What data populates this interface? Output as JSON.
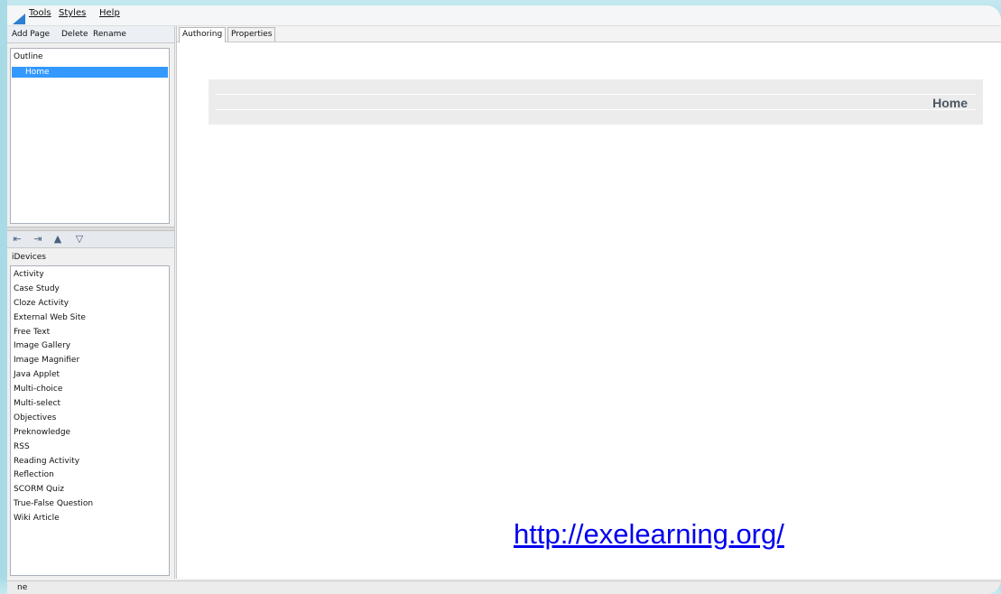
{
  "menubar": {
    "items": [
      "Tools",
      "Styles",
      "Help"
    ]
  },
  "outline_toolbar": {
    "add_page": "Add Page",
    "delete": "Delete",
    "rename": "Rename"
  },
  "outline": {
    "header": "Outline",
    "selected_item": "Home"
  },
  "move_toolbar": {
    "icons": [
      "promote-icon",
      "demote-icon",
      "move-up-icon",
      "move-down-icon"
    ]
  },
  "idevices": {
    "label": "iDevices",
    "items": [
      "Activity",
      "Case Study",
      "Cloze Activity",
      "External Web Site",
      "Free Text",
      "Image Gallery",
      "Image Magnifier",
      "Java Applet",
      "Multi-choice",
      "Multi-select",
      "Objectives",
      "Preknowledge",
      "RSS",
      "Reading Activity",
      "Reflection",
      "SCORM Quiz",
      "True-False Question",
      "Wiki Article"
    ]
  },
  "tabs": {
    "authoring": "Authoring",
    "properties": "Properties"
  },
  "main": {
    "page_title": "Home",
    "link_text": "http://exelearning.org/"
  },
  "statusbar": {
    "text": "ne"
  },
  "colors": {
    "selection": "#3399ff",
    "link": "#0000ee",
    "backdrop": "#a9dbe6"
  }
}
